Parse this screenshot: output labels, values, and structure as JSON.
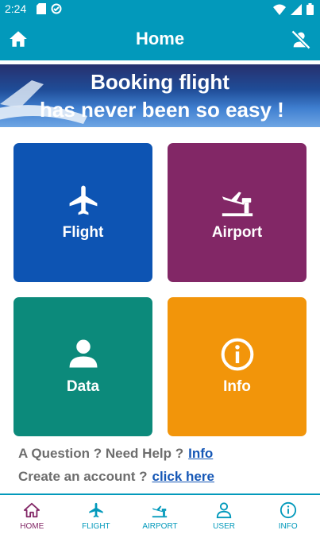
{
  "status_bar": {
    "time": "2:24"
  },
  "app_bar": {
    "title": "Home"
  },
  "banner": {
    "line1": "Booking flight",
    "line2": "has never been so easy !"
  },
  "tiles": [
    {
      "label": "Flight",
      "icon": "airplane-icon",
      "color": "#0D54B3"
    },
    {
      "label": "Airport",
      "icon": "airport-departures-icon",
      "color": "#822766"
    },
    {
      "label": "Data",
      "icon": "person-icon",
      "color": "#0C8A7B"
    },
    {
      "label": "Info",
      "icon": "info-icon",
      "color": "#F2950A"
    }
  ],
  "help": {
    "question_text": "A Question ? Need Help ?",
    "question_link": "Info",
    "account_text": "Create an account ?",
    "account_link": "click here"
  },
  "bottom_nav": [
    {
      "label": "HOME",
      "icon": "home-icon",
      "active": true
    },
    {
      "label": "FLIGHT",
      "icon": "airplane-icon",
      "active": false
    },
    {
      "label": "AIRPORT",
      "icon": "airport-departures-icon",
      "active": false
    },
    {
      "label": "USER",
      "icon": "person-icon",
      "active": false
    },
    {
      "label": "INFO",
      "icon": "info-icon",
      "active": false
    }
  ],
  "colors": {
    "primary": "#0299BB",
    "active_nav": "#822766",
    "link": "#1557b6"
  }
}
